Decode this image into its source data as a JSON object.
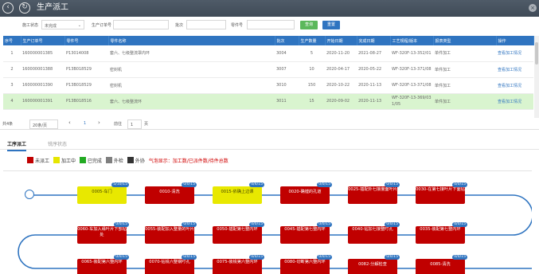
{
  "titlebar": {
    "title": "生产派工"
  },
  "filters": {
    "status_label": "施工状态",
    "status_value": "未完成",
    "order_label": "生产订单号",
    "batch_label": "批次",
    "part_label": "零件号",
    "search_label": "查询",
    "reset_label": "重置"
  },
  "table": {
    "headers": [
      "序号",
      "生产订单号",
      "零件号",
      "零件名称",
      "批次",
      "生产数量",
      "开始日期",
      "完成日期",
      "工艺规程/版本",
      "报表类型",
      "操作"
    ],
    "rows": [
      [
        "1",
        "160000001385",
        "P13014008",
        "套六、七级整流罩内环",
        "3004",
        "5",
        "2020-11-20",
        "2021-08-27",
        "WF-320F-13-352/01",
        "单件加工",
        "查看加工情况"
      ],
      [
        "2",
        "160000001388",
        "P13B018529",
        "密封机",
        "3007",
        "10",
        "2020-04-17",
        "2020-05-22",
        "WF-320F-13-371/08",
        "单件加工",
        "查看加工情况"
      ],
      [
        "3",
        "160000001390",
        "P13B018529",
        "密封机",
        "3010",
        "150",
        "2020-10-22",
        "2020-11-13",
        "WF-320F-13-371/08",
        "单件加工",
        "查看加工情况"
      ],
      [
        "4",
        "160000001391",
        "P13B018516",
        "套六、七级整流环",
        "3011",
        "15",
        "2020-09-02",
        "2020-11-13",
        "WF-320F-13-369/03 1/05",
        "单件加工",
        "查看加工情况"
      ]
    ]
  },
  "pager": {
    "total": "共4条",
    "page_size": "20条/页",
    "prev": "‹",
    "current": "1",
    "next": "›",
    "goto_label": "前往",
    "goto_value": "1",
    "page_unit": "页"
  },
  "tabs": [
    "工序派工",
    "铣序状态"
  ],
  "legend": {
    "items": [
      {
        "label": "未派工",
        "color": "#c00000"
      },
      {
        "label": "加工中",
        "color": "#e6e600"
      },
      {
        "label": "已完成",
        "color": "#22aa22"
      },
      {
        "label": "外检",
        "color": "#7f7f7f"
      },
      {
        "label": "外协",
        "color": "#333333"
      }
    ],
    "note": "气泡显示：加工数/已派件数/待件总数"
  },
  "colors": {
    "header_blue": "#2f74c0",
    "selected_row": "#d9f4cf",
    "node_red": "#c00000",
    "node_yellow": "#e8e800"
  },
  "flow": {
    "nodes": [
      {
        "label": "0005-车门",
        "count": "5/10/15",
        "color": "yellow"
      },
      {
        "label": "0010-清洗",
        "count": "0/0/15",
        "color": "red"
      },
      {
        "label": "0015-依确上边课",
        "count": "0/4/15",
        "color": "yellow"
      },
      {
        "label": "0020-确镗的孔道",
        "count": "0/0/15",
        "color": "red"
      },
      {
        "label": "0025-插配外七接度面叶片",
        "count": "0/0/15",
        "color": "red"
      },
      {
        "label": "0030-在第七接叶片下面钻",
        "count": "0/0/15",
        "color": "red"
      },
      {
        "label": "0060-车加入缘叶片下部钻处",
        "count": "0/0/15",
        "color": "red"
      },
      {
        "label": "0055-装配加入整量的叶片",
        "count": "0/0/15",
        "color": "red"
      },
      {
        "label": "0050-插配第七整内环",
        "count": "0/0/15",
        "color": "red"
      },
      {
        "label": "0045-插配第七整内环",
        "count": "0/0/15",
        "color": "red"
      },
      {
        "label": "0040-钻加七接整叮孔",
        "count": "0/0/15",
        "color": "red"
      },
      {
        "label": "0035-装配第七整内环",
        "count": "0/0/15",
        "color": "red"
      },
      {
        "label": "0065-装配第六整内环",
        "count": "0/0/15",
        "color": "red"
      },
      {
        "label": "0070-钻铣六整钢叮孔",
        "count": "0/0/15",
        "color": "red"
      },
      {
        "label": "0075-装铣第六整内环",
        "count": "0/0/15",
        "color": "red"
      },
      {
        "label": "0080-切断第六整内环",
        "count": "0/0/15",
        "color": "red"
      },
      {
        "label": "0082-分解检查",
        "count": "0/0/15",
        "color": "red"
      },
      {
        "label": "0085-清洗",
        "count": "0/0/15",
        "color": "red"
      }
    ]
  }
}
